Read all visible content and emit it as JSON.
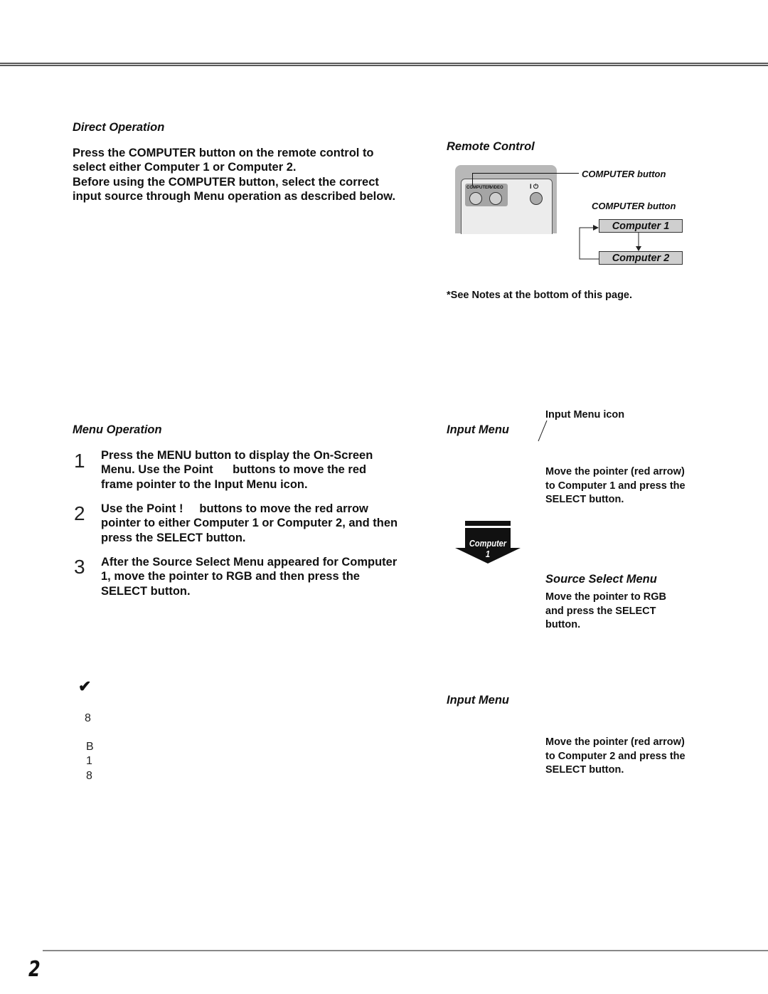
{
  "direct_operation": {
    "heading": "Direct Operation",
    "paragraph": [
      "Press the COMPUTER button on the remote control to",
      "select either Computer 1 or Computer 2.",
      "Before using the COMPUTER button, select the correct",
      "input source through Menu operation as described below."
    ]
  },
  "remote_control": {
    "heading": "Remote Control",
    "button_labels": [
      "COMPUTER",
      "VIDEO"
    ],
    "power_label": "I ⏻",
    "callout": "COMPUTER button",
    "flow_title": "COMPUTER button",
    "flow": [
      "Computer 1",
      "Computer 2"
    ],
    "note": "*See Notes at the bottom of this page."
  },
  "menu_operation": {
    "heading": "Menu Operation",
    "steps": [
      {
        "num": "1",
        "lines": [
          "Press the MENU button to display the On-Screen",
          "Menu. Use the Point      buttons to move the red",
          "frame pointer to the Input Menu icon."
        ]
      },
      {
        "num": "2",
        "lines": [
          "Use the Point !     buttons to move the red arrow",
          "pointer to either Computer 1 or Computer 2, and then",
          "press the SELECT button."
        ]
      },
      {
        "num": "3",
        "lines": [
          "After the Source Select Menu appeared for Computer",
          "1, move the pointer to RGB and then press the",
          "SELECT button."
        ]
      }
    ]
  },
  "input_menu_1": {
    "heading": "Input Menu",
    "icon_callout": "Input Menu icon",
    "instruction": [
      "Move the pointer (red arrow)",
      "to Computer 1 and press the",
      "SELECT button."
    ],
    "arrow_label": [
      "Computer",
      "1"
    ]
  },
  "source_select_menu": {
    "heading": "Source Select Menu",
    "instruction": [
      "Move the pointer to RGB",
      "and press the SELECT",
      "button."
    ]
  },
  "input_menu_2": {
    "heading": "Input Menu",
    "instruction": [
      "Move the pointer (red arrow)",
      "to Computer 2 and press the",
      "SELECT button."
    ]
  },
  "notes": {
    "check_icon": "✔",
    "glyphs": [
      "8",
      "B",
      "1",
      "8"
    ]
  },
  "page_number": "2"
}
